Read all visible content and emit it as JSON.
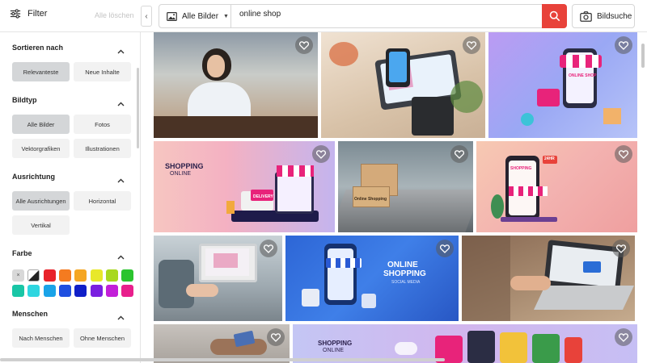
{
  "topbar": {
    "filter_label": "Filter",
    "clear_all_label": "Alle löschen",
    "collapse_glyph": "‹",
    "type_select_label": "Alle Bilder",
    "search_value": "online shop",
    "image_search_label": "Bildsuche",
    "icons": [
      "sliders-icon",
      "image-icon",
      "search-icon",
      "camera-icon"
    ]
  },
  "sidebar": {
    "sort": {
      "title": "Sortieren nach",
      "options": [
        "Relevanteste",
        "Neue Inhalte"
      ],
      "selected": "Relevanteste"
    },
    "type": {
      "title": "Bildtyp",
      "options": [
        "Alle Bilder",
        "Fotos",
        "Vektorgrafiken",
        "Illustrationen"
      ],
      "selected": "Alle Bilder"
    },
    "orientation": {
      "title": "Ausrichtung",
      "options": [
        "Alle Ausrichtungen",
        "Horizontal",
        "Vertikal"
      ],
      "selected": "Alle Ausrichtungen"
    },
    "color": {
      "title": "Farbe",
      "none_glyph": "×",
      "swatches": [
        "#e8232a",
        "#f47b20",
        "#f5a623",
        "#e8e82a",
        "#a8d81e",
        "#2bc42e",
        "#19c6a6",
        "#2ed6e0",
        "#1aa3e8",
        "#1f4fe0",
        "#0f1fc8",
        "#7a1fe0",
        "#c21fd8",
        "#e81f8c"
      ]
    },
    "people": {
      "title": "Menschen",
      "options": [
        "Nach Menschen",
        "Ohne Menschen"
      ]
    }
  },
  "tiles": [
    {
      "texts": []
    },
    {
      "texts": []
    },
    {
      "texts": [
        "ONLINE SHOP"
      ]
    },
    {
      "texts": [
        "SHOPPING",
        "ONLINE",
        "DELIVERY"
      ]
    },
    {
      "texts": [
        "Online Shopping"
      ]
    },
    {
      "texts": [
        "SHOPPING",
        "24HR"
      ]
    },
    {
      "texts": []
    },
    {
      "texts": [
        "ONLINE",
        "SHOPPING",
        "SOCIAL MEDIA"
      ]
    },
    {
      "texts": []
    },
    {
      "texts": []
    },
    {
      "texts": [
        "SHOPPING",
        "ONLINE"
      ]
    }
  ],
  "colors": {
    "accent": "#e8423a",
    "selected_option": "#d4d6d8"
  }
}
